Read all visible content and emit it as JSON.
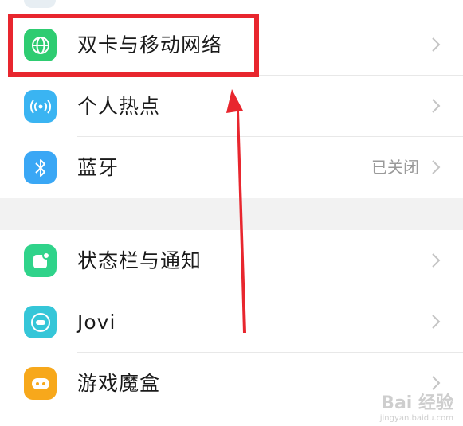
{
  "settings": {
    "items": [
      {
        "label": "双卡与移动网络",
        "value": "",
        "icon": "globe-icon",
        "color": "#2ecc71"
      },
      {
        "label": "个人热点",
        "value": "",
        "icon": "hotspot-icon",
        "color": "#3ab4f2"
      },
      {
        "label": "蓝牙",
        "value": "已关闭",
        "icon": "bluetooth-icon",
        "color": "#3aa7f5"
      },
      {
        "label": "状态栏与通知",
        "value": "",
        "icon": "notification-icon",
        "color": "#2fd38a"
      },
      {
        "label": "Jovi",
        "value": "",
        "icon": "jovi-icon",
        "color": "#35c6d8"
      },
      {
        "label": "游戏魔盒",
        "value": "",
        "icon": "game-controller-icon",
        "color": "#f7a81b"
      }
    ]
  },
  "annotation": {
    "highlight_color": "#e8262e"
  },
  "watermark": {
    "main": "Bai 经验",
    "sub": "jingyan.baidu.com"
  }
}
